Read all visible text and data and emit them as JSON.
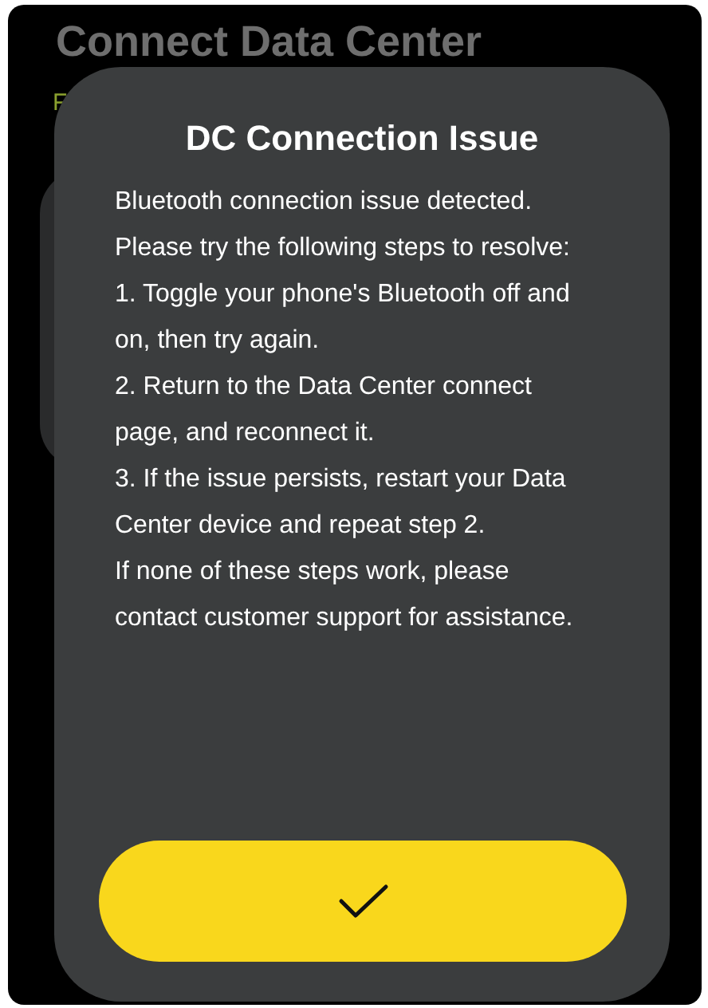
{
  "page": {
    "title": "Connect Data Center",
    "subtitle": "F"
  },
  "dialog": {
    "title": "DC Connection Issue",
    "paragraphs": [
      "Bluetooth connection issue detected. Please try the following steps to resolve:",
      "1. Toggle your phone's Bluetooth off and on, then try again.",
      "2. Return to the Data Center connect page, and reconnect it.",
      "3. If the issue persists, restart your Data Center device and repeat step 2.",
      "If none of these steps work, please contact customer support for assistance."
    ]
  }
}
